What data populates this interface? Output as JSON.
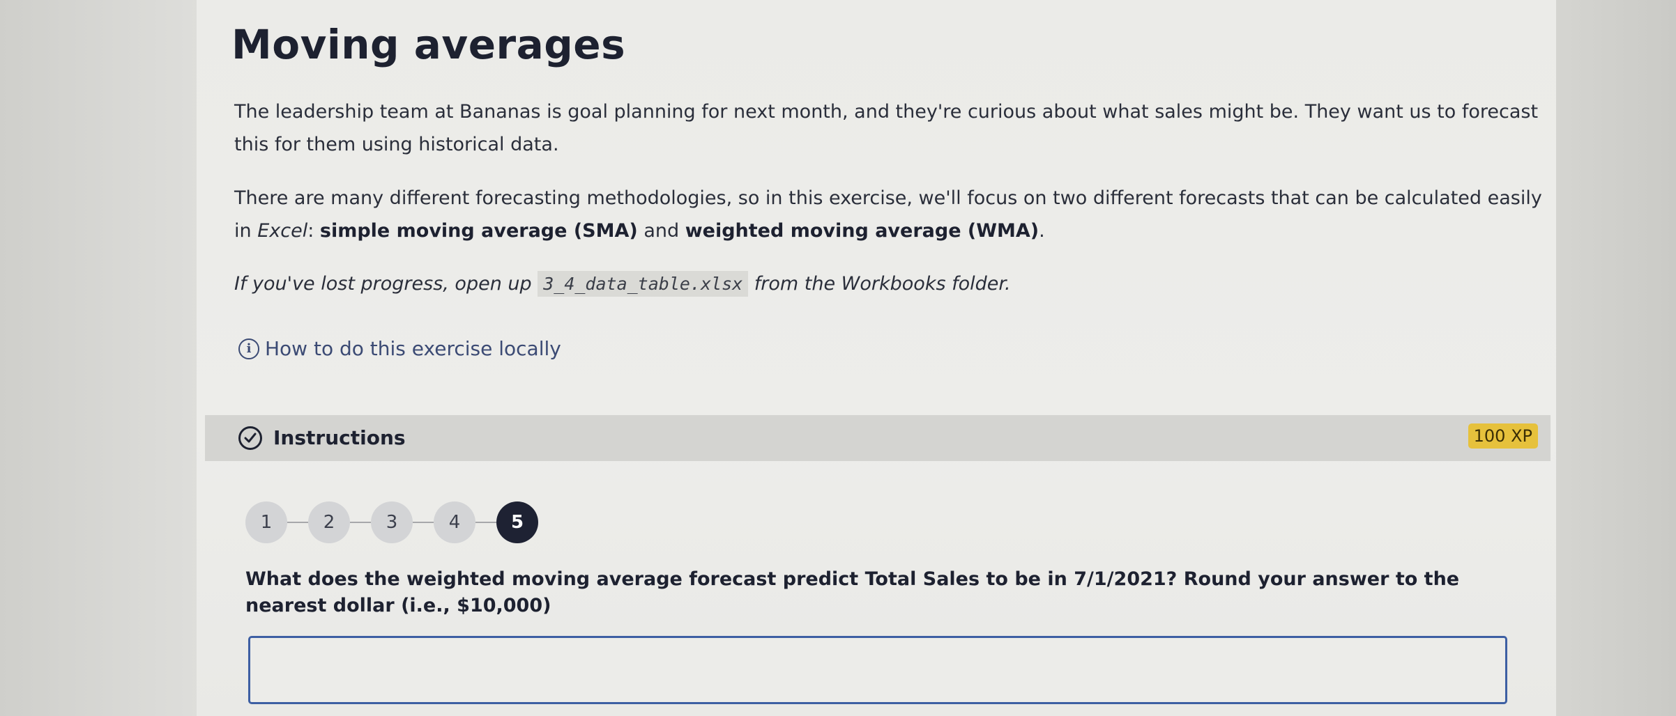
{
  "title": "Moving averages",
  "intro": {
    "p1": "The leadership team at Bananas is goal planning for next month, and they're curious about what sales might be. They want us to forecast this for them using historical data.",
    "p2_a": "There are many different forecasting methodologies, so in this exercise, we'll focus on two different forecasts that can be calculated easily in ",
    "p2_excel": "Excel",
    "p2_b": ": ",
    "p2_sma": "simple moving average (SMA)",
    "p2_c": " and ",
    "p2_wma": "weighted moving average (WMA)",
    "p2_d": ".",
    "p3_a": "If you've lost progress, open up ",
    "p3_file": "3_4_data_table.xlsx",
    "p3_b": " from the Workbooks folder."
  },
  "howto_link": "How to do this exercise locally",
  "instructions": {
    "label": "Instructions",
    "xp": "100 XP"
  },
  "steps": [
    "1",
    "2",
    "3",
    "4",
    "5"
  ],
  "active_step": 5,
  "question": "What does the weighted moving average forecast predict Total Sales to be in 7/1/2021? Round your answer to the nearest dollar (i.e., $10,000)",
  "answer": {
    "value": "",
    "placeholder": ""
  }
}
